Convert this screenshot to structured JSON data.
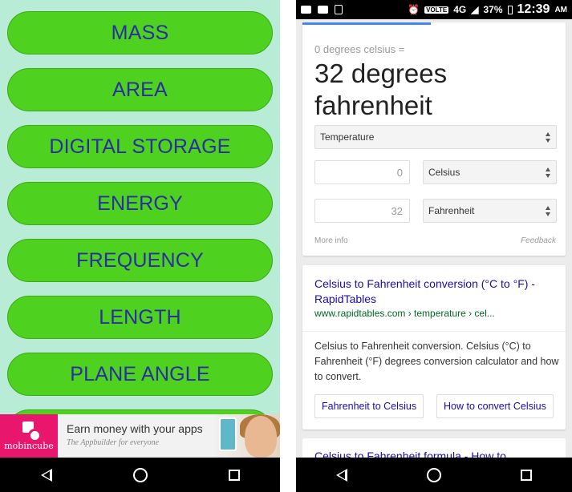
{
  "left_app": {
    "buttons": [
      "MASS",
      "AREA",
      "DIGITAL STORAGE",
      "ENERGY",
      "FREQUENCY",
      "LENGTH",
      "PLANE ANGLE"
    ],
    "ad": {
      "brand": "mobincube",
      "title": "Earn money with your apps",
      "subtitle": "The Appbuilder for everyone"
    }
  },
  "status_bar": {
    "volte": "VOLTE",
    "network": "4G",
    "battery": "37%",
    "time": "12:39",
    "ampm": "AM"
  },
  "converter": {
    "equation": "0 degrees celsius =",
    "result": "32 degrees fahrenheit",
    "category": "Temperature",
    "from_value": "0",
    "from_unit": "Celsius",
    "to_value": "32",
    "to_unit": "Fahrenheit",
    "more_info": "More info",
    "feedback": "Feedback"
  },
  "result1": {
    "title": "Celsius to Fahrenheit conversion (°C to °F) - RapidTables",
    "url": "www.rapidtables.com › temperature › cel...",
    "snippet": "Celsius to Fahrenheit conversion. Celsius (°C) to Fahrenheit (°F) degrees conversion calculator and how to convert.",
    "chips": [
      "Fahrenheit to Celsius",
      "How to convert Celsius"
    ]
  },
  "result2": {
    "title": "Celsius to Fahrenheit formula - How to"
  },
  "colors": {
    "left_bg": "#b8ecd6",
    "button_green": "#4fd11f",
    "button_text": "#2a2fa0",
    "link_blue": "#1a0dab",
    "url_green": "#006621"
  }
}
